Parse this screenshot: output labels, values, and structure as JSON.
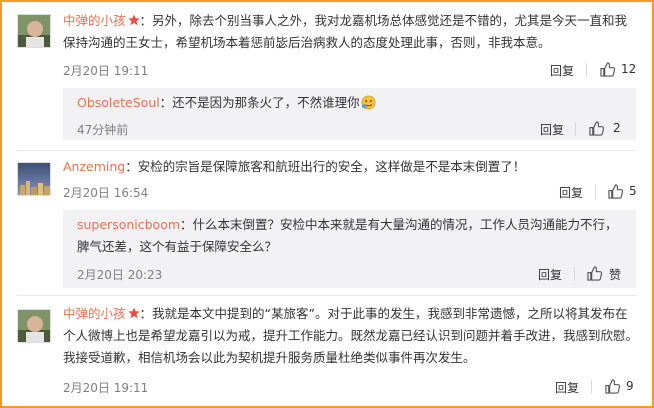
{
  "comments": [
    {
      "username": "中弹的小孩",
      "text": "：另外，除去个别当事人之外，我对龙嘉机场总体感觉还是不错的，尤其是今天一直和我保持沟通的王女士，希望机场本着惩前毖后治病救人的态度处理此事，否则，非我本意。",
      "time": "2月20日 19:11",
      "reply_label": "回复",
      "like_count": "12",
      "avatar_icon": "user-avatar-icon",
      "reply": {
        "username": "ObsoleteSoul",
        "text": "：还不是因为那条火了，不然谁理你",
        "time": "47分钟前",
        "reply_label": "回复",
        "like_count": "2"
      }
    },
    {
      "username": "Anzeming",
      "text": "：安检的宗旨是保障旅客和航班出行的安全，这样做是不是本末倒置了！",
      "time": "2月20日 16:54",
      "reply_label": "回复",
      "like_count": "5",
      "avatar_icon": "city-avatar-icon",
      "reply": {
        "username": "supersonicboom",
        "text": "：什么本末倒置？安检中本来就是有大量沟通的情况，工作人员沟通能力不行，脾气还差，这个有益于保障安全么？",
        "time": "2月20日 20:23",
        "reply_label": "回复",
        "like_count": "赞"
      }
    },
    {
      "username": "中弹的小孩",
      "text": "：我就是本文中提到的“某旅客”。对于此事的发生，我感到非常遗憾，之所以将其发布在个人微博上也是希望龙嘉引以为戒，提升工作能力。既然龙嘉已经认识到问题并着手改进，我感到欣慰。我接受道歉，相信机场会以此为契机提升服务质量杜绝类似事件再次发生。",
      "time": "2月20日 19:11",
      "reply_label": "回复",
      "like_count": "9",
      "avatar_icon": "user-avatar-icon"
    }
  ],
  "colors": {
    "username": "#eb7350",
    "frame_border": "#f59a23",
    "reply_bg": "#f2f2f5",
    "meta_text": "#808080"
  },
  "icons": {
    "thumb": "thumbs-up-icon",
    "crown": "vip-crown-icon",
    "emoji": "smiling-face-emoji-icon"
  }
}
